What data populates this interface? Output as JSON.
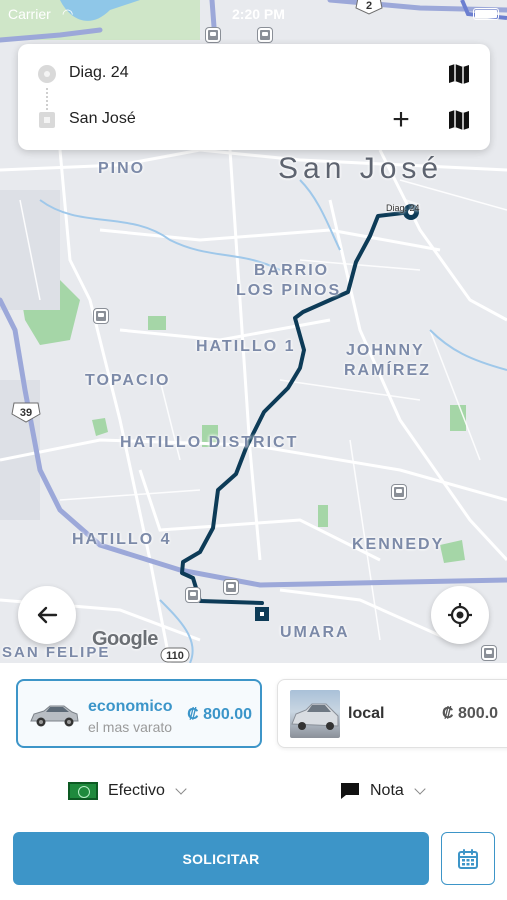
{
  "status_bar": {
    "carrier": "Carrier",
    "time": "2:20 PM"
  },
  "route": {
    "origin": "Diag. 24",
    "destination": "San José",
    "map_pin_label": "Diag. 24"
  },
  "map": {
    "city_label": "San José",
    "neighborhoods": [
      "PINO",
      "BARRIO",
      "LOS PINOS",
      "HATILLO 1",
      "JOHNNY",
      "RAMÍREZ",
      "TOPACIO",
      "HATILLO DISTRICT",
      "HATILLO 4",
      "KENNEDY",
      "UMARA",
      "SAN FELIPE"
    ],
    "road_shields": [
      "2",
      "39",
      "110"
    ],
    "attribution": "Google",
    "route_color": "#0d3b57"
  },
  "vehicles": [
    {
      "name": "economico",
      "subtitle": "el mas varato",
      "price": "₡ 800.00",
      "selected": true
    },
    {
      "name": "local",
      "price": "₡ 800.0",
      "selected": false
    }
  ],
  "payment": {
    "label": "Efectivo",
    "icon": "cash-icon"
  },
  "note": {
    "label": "Nota",
    "icon": "note-icon"
  },
  "actions": {
    "request_label": "SOLICITAR",
    "schedule_icon": "calendar-icon",
    "back_icon": "arrow-left-icon",
    "locate_icon": "crosshair-icon"
  },
  "colors": {
    "accent": "#3d95c8",
    "route": "#0d3b57"
  }
}
